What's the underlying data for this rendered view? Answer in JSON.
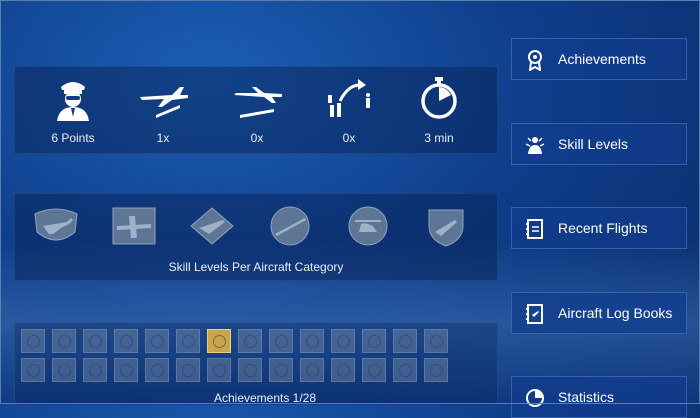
{
  "stats": [
    {
      "icon": "pilot-icon",
      "label": "6 Points"
    },
    {
      "icon": "takeoff-icon",
      "label": "1x"
    },
    {
      "icon": "landing-icon",
      "label": "0x"
    },
    {
      "icon": "maneuver-icon",
      "label": "0x"
    },
    {
      "icon": "stopwatch-icon",
      "label": "3 min"
    }
  ],
  "skills": {
    "title": "Skill Levels Per Aircraft Category",
    "badges": [
      "single-engine-badge-icon",
      "twin-engine-badge-icon",
      "jet-badge-icon",
      "glider-badge-icon",
      "helicopter-badge-icon",
      "shield-plane-badge-icon"
    ]
  },
  "achievements": {
    "title": "Achievements 1/28",
    "total": 28,
    "unlocked": 1
  },
  "menu": [
    {
      "icon": "award-icon",
      "label": "Achievements"
    },
    {
      "icon": "skill-icon",
      "label": "Skill Levels"
    },
    {
      "icon": "logbook-icon",
      "label": "Recent Flights"
    },
    {
      "icon": "logbook-icon",
      "label": "Aircraft Log Books"
    },
    {
      "icon": "pie-icon",
      "label": "Statistics"
    }
  ]
}
